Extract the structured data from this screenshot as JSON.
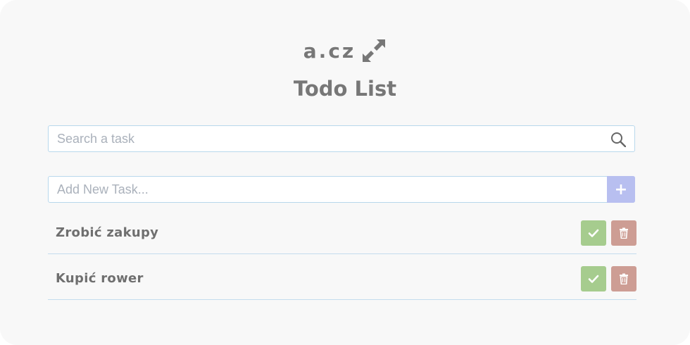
{
  "logo": {
    "text": "a.cz",
    "icon": "expand-arrows-icon"
  },
  "title": "Todo List",
  "search": {
    "placeholder": "Search a task",
    "value": "",
    "icon": "search-icon"
  },
  "add_task": {
    "placeholder": "Add New Task...",
    "value": "",
    "button_label": "+"
  },
  "tasks": [
    {
      "label": "Zrobić zakupy",
      "done_icon": "check-icon",
      "delete_icon": "trash-icon"
    },
    {
      "label": "Kupić rower",
      "done_icon": "check-icon",
      "delete_icon": "trash-icon"
    }
  ],
  "colors": {
    "background": "#f8f8f8",
    "text": "#777777",
    "border": "#b8d8ec",
    "add_button": "#b8bff0",
    "done_button": "#a6cc8e",
    "delete_button": "#cd9d94"
  }
}
